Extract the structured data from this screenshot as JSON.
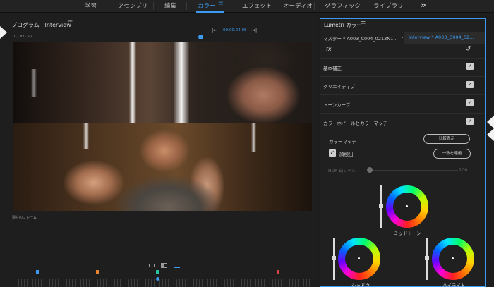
{
  "workspace": {
    "tabs": [
      "学習",
      "アセンブリ",
      "編集",
      "カラー",
      "エフェクト",
      "オーディオ",
      "グラフィック",
      "ライブラリ"
    ],
    "active_tab": "カラー",
    "active_menu_icon": "hamburger-icon",
    "more_icon": "double-chevron-right-icon",
    "accent_color": "#3c9bf0"
  },
  "program": {
    "title": "プログラム : Interview",
    "menu_icon": "hamburger-icon",
    "reference_label": "リファレンス",
    "reference_timecode": "00:00:04:08",
    "current_frame_label": "現在のフレーム"
  },
  "lumetri": {
    "title": "Lumetri カラー",
    "menu_icon": "hamburger-icon",
    "master_label": "マスター * A003_C004_0213N1...",
    "clip_label": "Interview * A003_C004_02...",
    "fx_label": "fx",
    "sections": [
      {
        "label": "基本補正",
        "checked": true
      },
      {
        "label": "クリエイティブ",
        "checked": true
      },
      {
        "label": "トーンカーブ",
        "checked": true
      },
      {
        "label": "カラーホイールとカラーマッチ",
        "checked": true
      }
    ],
    "color_match_label": "カラーマッチ",
    "compare_button": "比較表示",
    "face_detect_label": "顔検出",
    "face_detect_checked": true,
    "apply_button": "一致を適用",
    "hdr_label": "HDR 白レベル",
    "hdr_value": "100",
    "wheels": {
      "midtones": "ミッドトーン",
      "shadows": "シャドウ",
      "highlights": "ハイライト"
    }
  }
}
